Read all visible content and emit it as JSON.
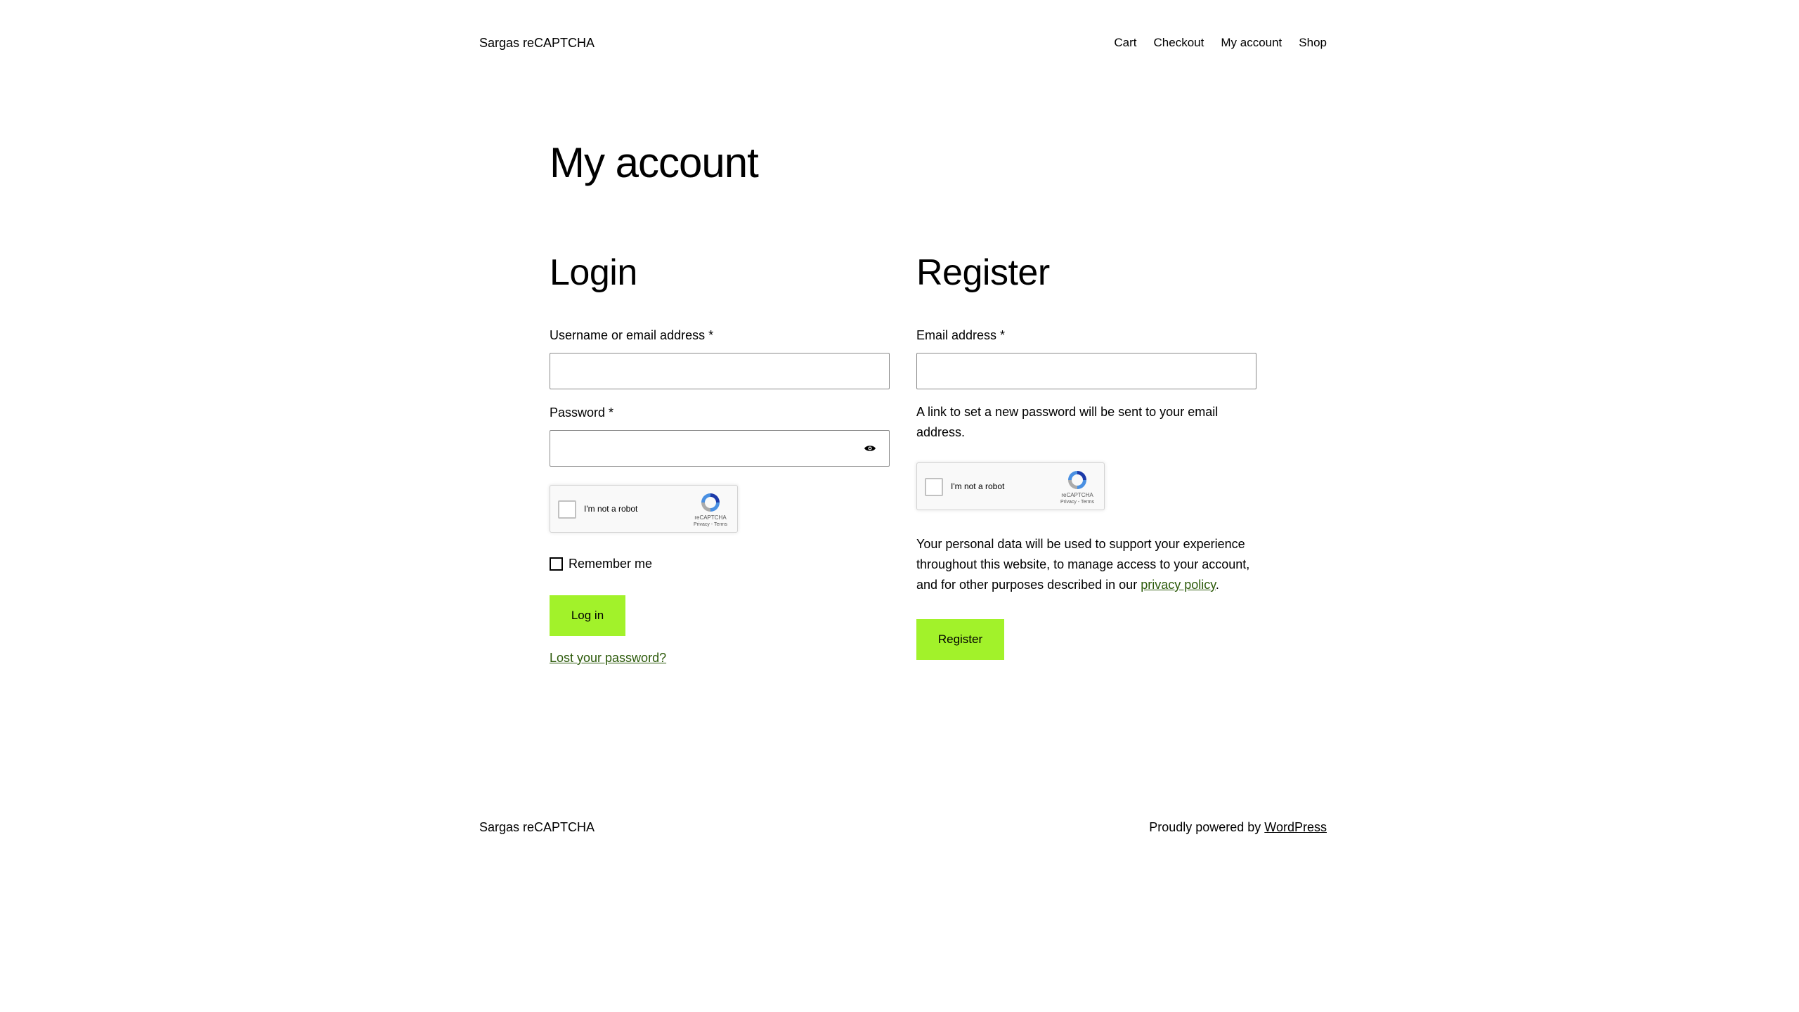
{
  "header": {
    "site_title": "Sargas reCAPTCHA",
    "nav": [
      "Cart",
      "Checkout",
      "My account",
      "Shop"
    ]
  },
  "page_title": "My account",
  "login": {
    "title": "Login",
    "username_label": "Username or email address",
    "password_label": "Password",
    "required_marker": "*",
    "captcha": {
      "text": "I'm not a robot",
      "brand": "reCAPTCHA",
      "links": "Privacy - Terms"
    },
    "remember_label": "Remember me",
    "submit_label": "Log in",
    "lost_password": "Lost your password?"
  },
  "register": {
    "title": "Register",
    "email_label": "Email address",
    "required_marker": "*",
    "hint": "A link to set a new password will be sent to your email address.",
    "captcha": {
      "text": "I'm not a robot",
      "brand": "reCAPTCHA",
      "links": "Privacy - Terms"
    },
    "privacy_text": "Your personal data will be used to support your experience throughout this website, to manage access to your account, and for other purposes described in our",
    "privacy_link": "privacy policy",
    "privacy_end": ".",
    "submit_label": "Register"
  },
  "footer": {
    "site_title": "Sargas reCAPTCHA",
    "credit_text": "Proudly powered by",
    "credit_link": "WordPress"
  },
  "colors": {
    "button": "#a2f22a",
    "link": "#2c5a0a"
  }
}
